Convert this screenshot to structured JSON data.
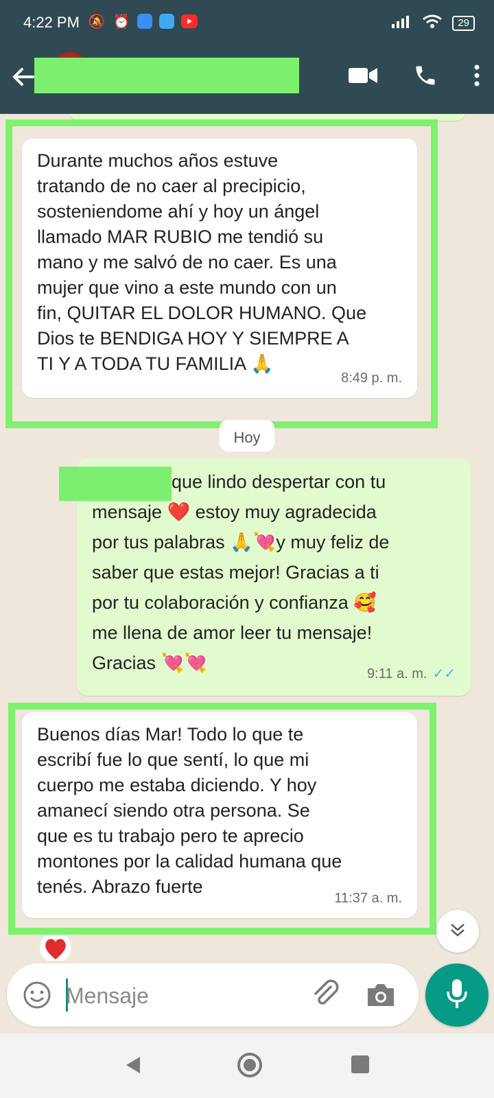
{
  "status_bar": {
    "time": "4:22 PM",
    "battery": "29"
  },
  "header": {
    "contact_name": "",
    "icons": [
      "back-arrow-icon",
      "video-call-icon",
      "phone-icon",
      "more-vert-icon"
    ]
  },
  "messages": [
    {
      "id": "m0",
      "direction": "incoming",
      "time": "8:49 p. m.",
      "text": "Durante muchos años estuve\ntratando de no caer al precipicio,\nsosteniendome ahí y hoy un ángel\nllamado MAR RUBIO me tendió su\nmano y me salvó de no caer. Es una\nmujer que vino a este mundo con un\nfin, QUITAR EL DOLOR HUMANO. Que\nDios te BENDIGA HOY Y SIEMPRE A\nTI Y A TODA TU FAMILIA 🙏"
    },
    {
      "id": "m1",
      "direction": "outgoing",
      "time": "9:11 a. m.",
      "text": "que lindo despertar con tu\nmensaje ❤️ estoy muy agradecida\npor tus palabras 🙏💘y muy feliz de\nsaber que estas mejor! Gracias a ti\npor tu colaboración y confianza 🥰\nme llena de amor leer tu mensaje!\nGracias 💘💘"
    },
    {
      "id": "m2",
      "direction": "incoming",
      "time": "11:37 a. m.",
      "text": "Buenos días Mar! Todo lo que te\nescribí fue lo que sentí, lo que mi\ncuerpo me estaba diciendo. Y hoy\namanecí siendo otra persona. Se\nque es tu trabajo pero te aprecio\nmontones por la calidad humana que\ntenés. Abrazo fuerte"
    }
  ],
  "date_chip": "Hoy",
  "input": {
    "placeholder": "Mensaje"
  },
  "colors": {
    "header": "#2f4a52",
    "outgoing_bubble": "#e1fbcf",
    "incoming_bubble": "#ffffff",
    "highlight_border": "#7ef26c",
    "mic_button": "#069b87",
    "read_ticks": "#4ab3f4"
  }
}
